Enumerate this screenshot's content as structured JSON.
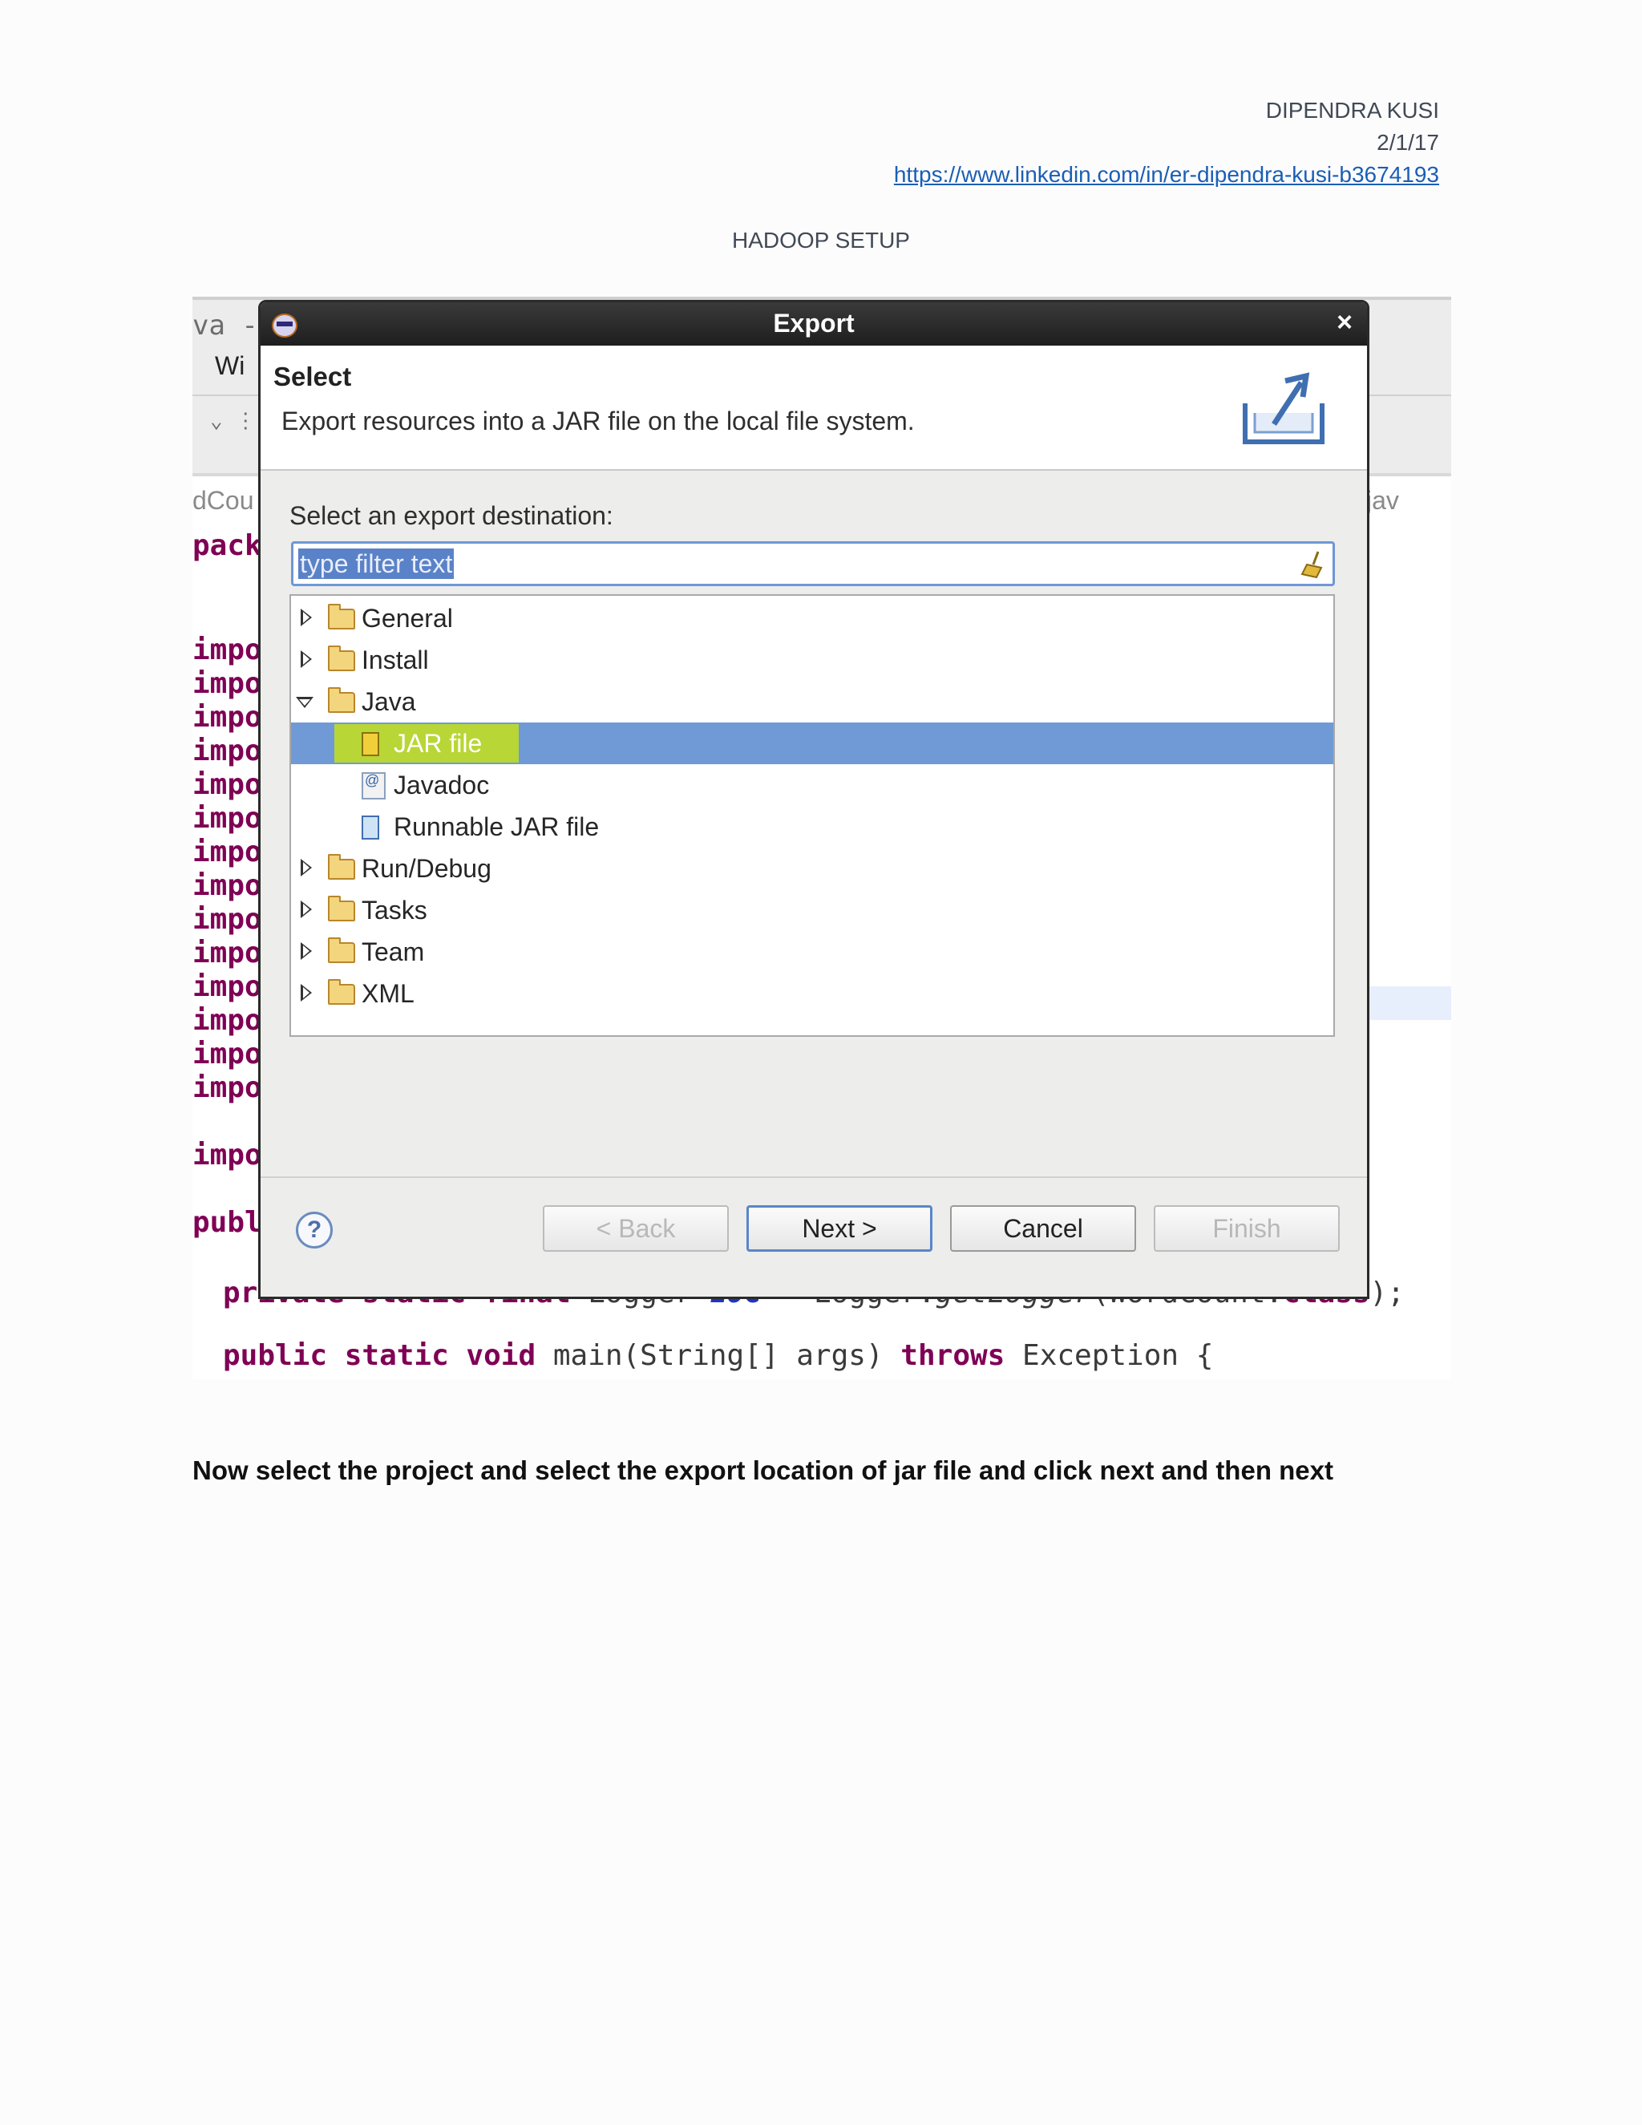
{
  "header": {
    "author": "DIPENDRA KUSI",
    "date": "2/1/17",
    "url": "https://www.linkedin.com/in/er-dipendra-kusi-b3674193",
    "doc_title": "HADOOP SETUP"
  },
  "ide_background": {
    "window_title_fragment": "va -",
    "menu_fragment": "Wi",
    "toolbar_fragment": "⌄ ⋮",
    "tab_left_fragment": "dCou",
    "tab_right_fragment": "jav",
    "code_left_fragments": [
      "pack",
      "impo",
      "impo",
      "impo",
      "impo",
      "impo",
      "impo",
      "impo",
      "impo",
      "impo",
      "impo",
      "impo",
      "impo",
      "impo",
      "impo",
      "impo",
      "publ"
    ],
    "code_line_1": {
      "kw": "private static final",
      "t1": " Logger ",
      "field": "LOG",
      "t2": " = Logger.",
      "method": "getLogger",
      "t3": "(WordCount.",
      "kw2": "class",
      "t4": ");"
    },
    "code_line_2": {
      "kw": "public static void",
      "t1": " main(String[] args) ",
      "kw2": "throws",
      "t2": " Exception {"
    }
  },
  "dialog": {
    "title": "Export",
    "close_label": "×",
    "banner_heading": "Select",
    "banner_description": "Export resources into a JAR file on the local file system.",
    "destination_label": "Select an export destination:",
    "filter_placeholder": "type filter text",
    "tree": [
      {
        "label": "General",
        "level": 0,
        "state": "closed"
      },
      {
        "label": "Install",
        "level": 0,
        "state": "closed"
      },
      {
        "label": "Java",
        "level": 0,
        "state": "open"
      },
      {
        "label": "JAR file",
        "level": 1,
        "selected": true
      },
      {
        "label": "Javadoc",
        "level": 1
      },
      {
        "label": "Runnable JAR file",
        "level": 1
      },
      {
        "label": "Run/Debug",
        "level": 0,
        "state": "closed"
      },
      {
        "label": "Tasks",
        "level": 0,
        "state": "closed"
      },
      {
        "label": "Team",
        "level": 0,
        "state": "closed"
      },
      {
        "label": "XML",
        "level": 0,
        "state": "closed"
      }
    ],
    "help_label": "?",
    "buttons": {
      "back": "< Back",
      "next": "Next >",
      "cancel": "Cancel",
      "finish": "Finish"
    }
  },
  "caption": "Now select the project and select the export location of jar file and click next and then next"
}
